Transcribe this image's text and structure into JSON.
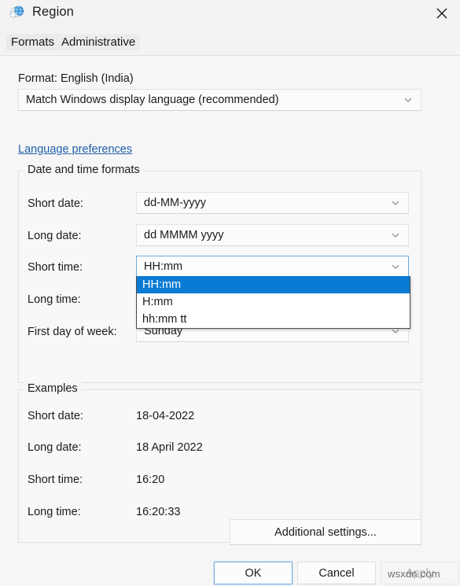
{
  "window": {
    "title": "Region",
    "icon": "region-globe-icon",
    "close_label": "✕"
  },
  "tabs": [
    {
      "id": "formats",
      "label": "Formats",
      "active": true
    },
    {
      "id": "administrative",
      "label": "Administrative",
      "active": false
    }
  ],
  "format_section": {
    "label": "Format: English (India)",
    "combo_value": "Match Windows display language (recommended)"
  },
  "language_preferences_link": "Language preferences",
  "date_time_group": {
    "legend": "Date and time formats",
    "rows": [
      {
        "label": "Short date:",
        "value": "dd-MM-yyyy"
      },
      {
        "label": "Long date:",
        "value": "dd MMMM yyyy"
      },
      {
        "label": "Short time:",
        "value": "HH:mm"
      },
      {
        "label": "Long time:",
        "value": ""
      },
      {
        "label": "First day of week:",
        "value": "Sunday"
      }
    ]
  },
  "short_time_dropdown": {
    "open": true,
    "selected": "HH:mm",
    "options": [
      "HH:mm",
      "H:mm",
      "hh:mm tt"
    ]
  },
  "examples_group": {
    "legend": "Examples",
    "rows": [
      {
        "label": "Short date:",
        "value": "18-04-2022"
      },
      {
        "label": "Long date:",
        "value": "18 April 2022"
      },
      {
        "label": "Short time:",
        "value": "16:20"
      },
      {
        "label": "Long time:",
        "value": "16:20:33"
      }
    ]
  },
  "buttons": {
    "additional_settings": "Additional settings...",
    "ok": "OK",
    "cancel": "Cancel",
    "apply": "Apply"
  },
  "watermark": "wsxdn.com",
  "colors": {
    "highlight": "#0a7bd4",
    "link": "#1f5fa8",
    "window_bg": "#f6f6f6",
    "titlebar_bg": "#f3f3f3"
  }
}
